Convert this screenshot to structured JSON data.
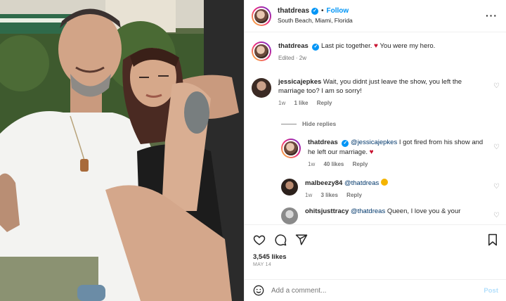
{
  "header": {
    "username": "thatdreas",
    "follow_label": "Follow",
    "location": "South Beach, Miami, Florida",
    "more_icon": "more-horizontal-icon"
  },
  "caption": {
    "username": "thatdreas",
    "text": "Last pic together.",
    "text_after": "You were my hero.",
    "meta": "Edited · 2w"
  },
  "comments": [
    {
      "username": "jessicajepkes",
      "text": "Wait, you didnt just leave the show, you left the marriage too? I am so sorry!",
      "time": "1w",
      "likes": "1 like",
      "reply": "Reply"
    }
  ],
  "hide_replies_label": "Hide replies",
  "replies": [
    {
      "username": "thatdreas",
      "mention": "@jessicajepkes",
      "text": "I got fired from his show and he left our marriage.",
      "time": "1w",
      "likes": "40 likes",
      "reply": "Reply"
    },
    {
      "username": "malbeezy84",
      "mention": "@thatdreas",
      "time": "1w",
      "likes": "3 likes",
      "reply": "Reply"
    },
    {
      "username": "ohitsjusttracy",
      "mention": "@thatdreas",
      "text": "Queen, I love you & your"
    }
  ],
  "actions": {
    "likes": "3,545 likes",
    "date": "MAY 14"
  },
  "add_comment": {
    "placeholder": "Add a comment...",
    "post_label": "Post"
  },
  "colors": {
    "accent": "#0095f6",
    "heart": "#c8102e",
    "muted": "#737373"
  }
}
